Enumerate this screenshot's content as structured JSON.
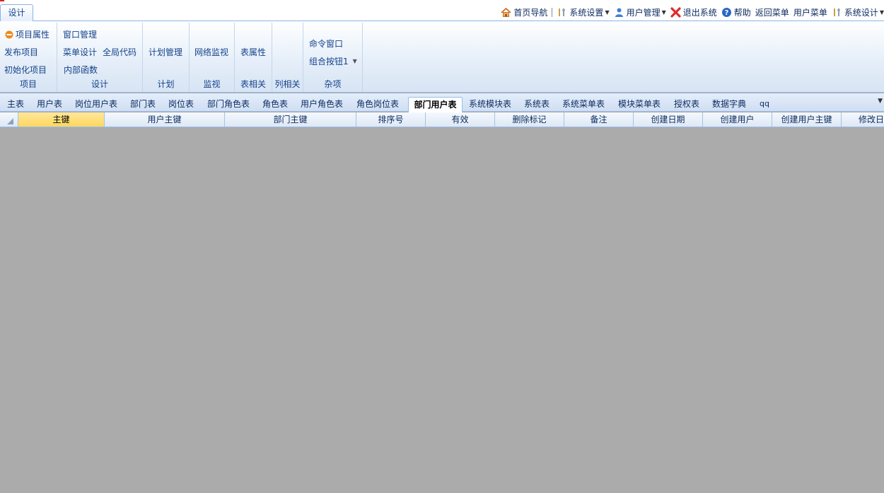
{
  "ribbon_tab": "设计",
  "topbar": {
    "home_nav": "首页导航",
    "system_settings": "系统设置",
    "user_manage": "用户管理",
    "logout": "退出系统",
    "help": "帮助",
    "back_menu": "返回菜单",
    "user_menu": "用户菜单",
    "system_design": "系统设计"
  },
  "ribbon": {
    "project": {
      "label": "项目",
      "props": "项目属性",
      "publish": "发布项目",
      "init": "初始化项目"
    },
    "design": {
      "label": "设计",
      "window_manage": "窗口管理",
      "menu_design": "菜单设计",
      "global_code": "全局代码",
      "inner_func": "内部函数"
    },
    "plan": {
      "label": "计划",
      "plan_manage": "计划管理"
    },
    "monitor": {
      "label": "监视",
      "net_monitor": "网络监视"
    },
    "table_rel": {
      "label": "表相关",
      "table_props": "表属性"
    },
    "column_rel": {
      "label": "列相关"
    },
    "misc": {
      "label": "杂项",
      "command_window": "命令窗口",
      "combo_button": "组合按钮1"
    }
  },
  "doc_tabs": [
    "主表",
    "用户表",
    "岗位用户表",
    "部门表",
    "岗位表",
    "部门角色表",
    "角色表",
    "用户角色表",
    "角色岗位表",
    "部门用户表",
    "系统模块表",
    "系统表",
    "系统菜单表",
    "模块菜单表",
    "授权表",
    "数据字典",
    "qq"
  ],
  "active_tab": "部门用户表",
  "grid_columns": [
    "主键",
    "用户主键",
    "部门主键",
    "排序号",
    "有效",
    "删除标记",
    "备注",
    "创建日期",
    "创建用户",
    "创建用户主键",
    "修改日"
  ],
  "colors": {
    "ribbon_text": "#15428b",
    "selected_header": "#ffd65c",
    "workspace": "#ababab",
    "border": "#99bbe8"
  }
}
